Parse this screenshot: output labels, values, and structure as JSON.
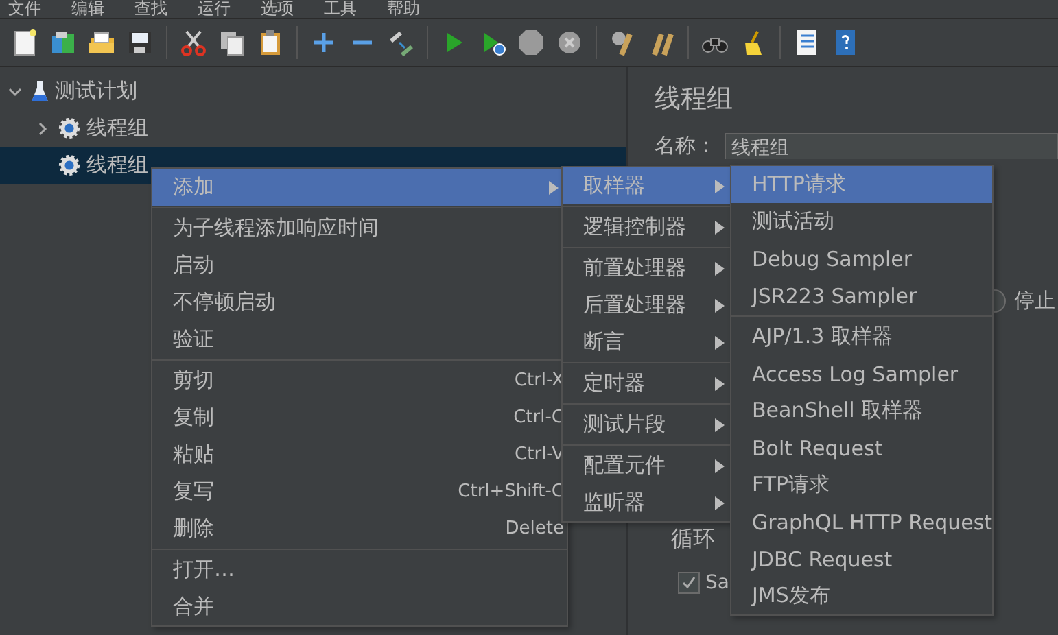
{
  "menu_bar": [
    "文件",
    "编辑",
    "查找",
    "运行",
    "选项",
    "工具",
    "帮助"
  ],
  "tree": [
    {
      "label": "测试计划",
      "kind": "plan",
      "expanded": true,
      "selected": false,
      "children": [
        {
          "label": "线程组",
          "kind": "thread-group",
          "expanded": false,
          "selected": false
        },
        {
          "label": "线程组",
          "kind": "thread-group",
          "selected": true
        }
      ]
    }
  ],
  "panel": {
    "title": "线程组",
    "name_label": "名称：",
    "name_value": "线程组",
    "radio_label": "停止",
    "radio_selected": false,
    "loop_label": "循环",
    "checkbox_label": "Sa",
    "checkbox_checked": true
  },
  "context_menu": [
    [
      {
        "label": "添加",
        "submenu": true,
        "selected": true
      }
    ],
    [
      {
        "label": "为子线程添加响应时间",
        "submenu": false,
        "selected": false
      },
      {
        "label": "启动",
        "submenu": false,
        "selected": false
      },
      {
        "label": "不停顿启动",
        "submenu": false,
        "selected": false
      },
      {
        "label": "验证",
        "submenu": false,
        "selected": false
      }
    ],
    [
      {
        "label": "剪切",
        "shortcut": "Ctrl-X",
        "submenu": false,
        "selected": false
      },
      {
        "label": "复制",
        "shortcut": "Ctrl-C",
        "submenu": false,
        "selected": false
      },
      {
        "label": "粘贴",
        "shortcut": "Ctrl-V",
        "submenu": false,
        "selected": false
      },
      {
        "label": "复写",
        "shortcut": "Ctrl+Shift-C",
        "submenu": false,
        "selected": false
      },
      {
        "label": "删除",
        "shortcut": "Delete",
        "submenu": false,
        "selected": false
      }
    ],
    [
      {
        "label": "打开…",
        "submenu": false,
        "selected": false
      },
      {
        "label": "合并",
        "submenu": false,
        "selected": false
      }
    ]
  ],
  "add_submenu": [
    [
      {
        "label": "取样器",
        "submenu": true,
        "selected": true
      }
    ],
    [
      {
        "label": "逻辑控制器",
        "submenu": true,
        "selected": false
      }
    ],
    [
      {
        "label": "前置处理器",
        "submenu": true,
        "selected": false
      },
      {
        "label": "后置处理器",
        "submenu": true,
        "selected": false
      },
      {
        "label": "断言",
        "submenu": true,
        "selected": false
      }
    ],
    [
      {
        "label": "定时器",
        "submenu": true,
        "selected": false
      }
    ],
    [
      {
        "label": "测试片段",
        "submenu": true,
        "selected": false
      }
    ],
    [
      {
        "label": "配置元件",
        "submenu": true,
        "selected": false
      },
      {
        "label": "监听器",
        "submenu": true,
        "selected": false
      }
    ]
  ],
  "sampler_submenu": [
    [
      {
        "label": "HTTP请求",
        "submenu": false,
        "selected": true
      },
      {
        "label": "测试活动",
        "submenu": false,
        "selected": false
      },
      {
        "label": "Debug Sampler",
        "submenu": false,
        "selected": false
      },
      {
        "label": "JSR223 Sampler",
        "submenu": false,
        "selected": false
      }
    ],
    [
      {
        "label": "AJP/1.3 取样器",
        "submenu": false,
        "selected": false
      },
      {
        "label": "Access Log Sampler",
        "submenu": false,
        "selected": false
      },
      {
        "label": "BeanShell 取样器",
        "submenu": false,
        "selected": false
      },
      {
        "label": "Bolt Request",
        "submenu": false,
        "selected": false
      },
      {
        "label": "FTP请求",
        "submenu": false,
        "selected": false
      },
      {
        "label": "GraphQL HTTP Request",
        "submenu": false,
        "selected": false
      },
      {
        "label": "JDBC Request",
        "submenu": false,
        "selected": false
      },
      {
        "label": "JMS发布",
        "submenu": false,
        "selected": false
      }
    ]
  ]
}
